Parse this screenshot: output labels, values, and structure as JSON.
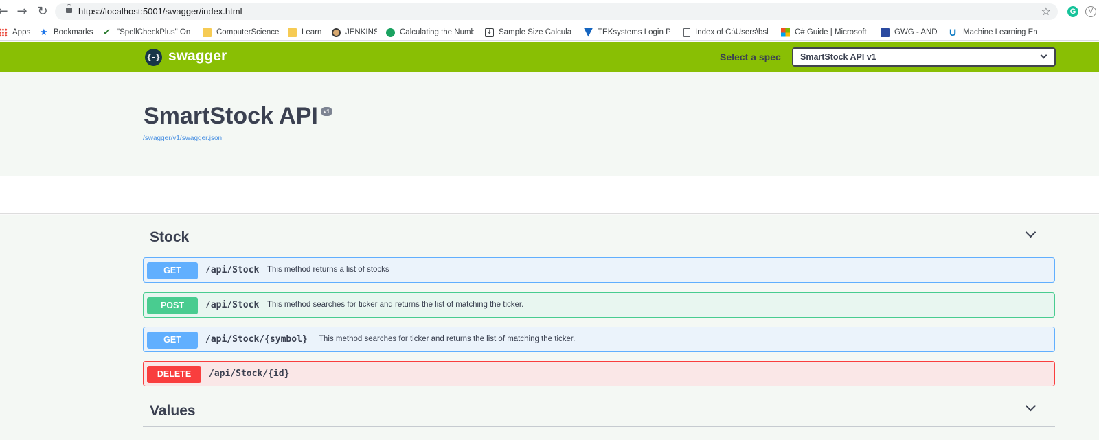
{
  "browser": {
    "url": "https://localhost:5001/swagger/index.html",
    "bookmarks": [
      {
        "label": "Apps",
        "icon": "apps-icon"
      },
      {
        "label": "Bookmarks",
        "icon": "star-icon"
      },
      {
        "label": "\"SpellCheckPlus\" Onl",
        "icon": "spellcheck-icon"
      },
      {
        "label": "ComputerScience",
        "icon": "folder-icon"
      },
      {
        "label": "Learn",
        "icon": "folder-icon"
      },
      {
        "label": "JENKINS",
        "icon": "jenkins-icon"
      },
      {
        "label": "Calculating the Numb",
        "icon": "calculator-icon"
      },
      {
        "label": "Sample Size Calculato",
        "icon": "download-icon"
      },
      {
        "label": "TEKsystems Login Pa",
        "icon": "tek-icon"
      },
      {
        "label": "Index of C:\\Users\\bsl",
        "icon": "file-icon"
      },
      {
        "label": "C# Guide | Microsoft",
        "icon": "microsoft-icon"
      },
      {
        "label": "GWG - AND",
        "icon": "gwg-icon"
      },
      {
        "label": "Machine Learning En",
        "icon": "udemy-icon"
      }
    ]
  },
  "topbar": {
    "logo_symbol": "{-}",
    "logo_text": "swagger",
    "spec_label": "Select a spec",
    "spec_selected": "SmartStock API v1",
    "brand_color": "#89bf04"
  },
  "info": {
    "title": "SmartStock API",
    "version": "v1",
    "spec_link": "/swagger/v1/swagger.json"
  },
  "tags": [
    {
      "name": "Stock",
      "operations": [
        {
          "method": "GET",
          "path": "/api/Stock",
          "description": "This method returns a list of stocks"
        },
        {
          "method": "POST",
          "path": "/api/Stock",
          "description": "This method searches for ticker and returns the list of matching the ticker."
        },
        {
          "method": "GET",
          "path": "/api/Stock/{symbol}",
          "description": "This method searches for ticker and returns the list of matching the ticker."
        },
        {
          "method": "DELETE",
          "path": "/api/Stock/{id}",
          "description": ""
        }
      ]
    },
    {
      "name": "Values",
      "operations": []
    }
  ],
  "method_colors": {
    "GET": "#61affe",
    "POST": "#49cc90",
    "DELETE": "#f93e3e"
  }
}
